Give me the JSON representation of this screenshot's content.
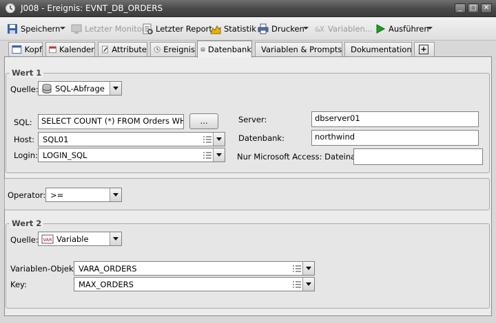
{
  "window": {
    "title": "J008 - Ereignis: EVNT_DB_ORDERS",
    "controls": {
      "minimize": "_",
      "maximize": "□",
      "close": "✕"
    }
  },
  "toolbar": {
    "save": "Speichern",
    "last_monitor": "Letzter Monitor",
    "last_report": "Letzter Report",
    "statistics": "Statistik",
    "print": "Drucken",
    "variables": "Variablen...",
    "execute": "Ausführen"
  },
  "tabs": [
    {
      "label": "Kopf",
      "icon": "header-icon"
    },
    {
      "label": "Kalender",
      "icon": "calendar-icon"
    },
    {
      "label": "Attribute",
      "icon": "attributes-icon"
    },
    {
      "label": "Ereignis",
      "icon": "event-clock-icon"
    },
    {
      "label": "Datenbank",
      "icon": "database-icon",
      "active": true
    },
    {
      "label": "Variablen & Prompts",
      "icon": "variables-icon"
    },
    {
      "label": "Dokumentation",
      "icon": "documentation-icon"
    },
    {
      "label": "+",
      "icon": "add-tab-icon"
    }
  ],
  "value1": {
    "title": "Wert 1",
    "source_label": "Quelle:",
    "source_value": "SQL-Abfrage",
    "sql_label": "SQL:",
    "sql_value": "SELECT COUNT (*) FROM Orders WHERE",
    "browse_button": "...",
    "host_label": "Host:",
    "host_value": "SQL01",
    "login_label": "Login:",
    "login_value": "LOGIN_SQL",
    "server_label": "Server:",
    "server_value": "dbserver01",
    "database_label": "Datenbank:",
    "database_value": "northwind",
    "access_label": "Nur Microsoft Access: Dateiname:",
    "access_value": ""
  },
  "operator": {
    "label": "Operator:",
    "value": ">="
  },
  "value2": {
    "title": "Wert 2",
    "source_label": "Quelle:",
    "source_value": "Variable",
    "var_object_label": "Variablen-Objekt:",
    "var_object_value": "VARA_ORDERS",
    "key_label": "Key:",
    "key_value": "MAX_ORDERS"
  },
  "colors": {
    "titlebar": "#4b4b4b",
    "accent_green": "#1aa01a",
    "panel_bg": "#ececec"
  }
}
